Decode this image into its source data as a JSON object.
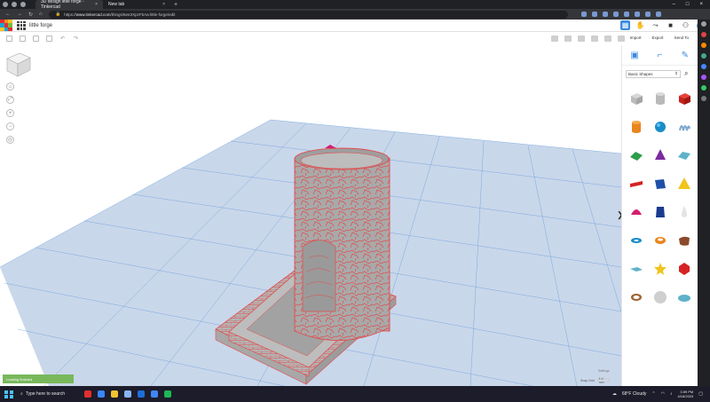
{
  "browser": {
    "tabs": [
      {
        "label": "3D design little forge - Tinkercad",
        "active": true
      },
      {
        "label": "New tab",
        "active": false
      }
    ],
    "url": {
      "scheme": "https://",
      "host": "www.tinkercad.com",
      "path": "/things/6ee2XpzFbAa-little-forge/edit"
    }
  },
  "app": {
    "project_title": "little forge",
    "header_actions": [
      "Import",
      "Export",
      "Send To"
    ],
    "accent": "#3b8be0"
  },
  "workplane": {
    "settings_label": "Settings",
    "snap_label": "Snap Grid",
    "snap_value": "1.0 mm",
    "plane_color": "#c9d7ea",
    "grid_color": "#4f8fd8"
  },
  "panel": {
    "category": "Basic Shapes",
    "shapes": [
      "box-grey",
      "cylinder-grey",
      "box-red",
      "cylinder-orange",
      "sphere-blue",
      "scribble-blue",
      "roof-green",
      "cone-purple",
      "roof-teal",
      "text-red",
      "box-blue",
      "pyramid-yellow",
      "half-sphere-pink",
      "polygon-navy",
      "paraboloid-white",
      "torus-blue",
      "tube-orange",
      "wedge-brown",
      "star-blue",
      "star-yellow",
      "icosahedron-red",
      "ring-brown",
      "sphere-white",
      "round-roof-teal"
    ]
  },
  "toast": {
    "text": "Loading finished"
  },
  "taskbar": {
    "search_placeholder": "Type here to search",
    "weather": "68°F Cloudy",
    "time": "3:59 PM",
    "date": "4/18/2023"
  }
}
